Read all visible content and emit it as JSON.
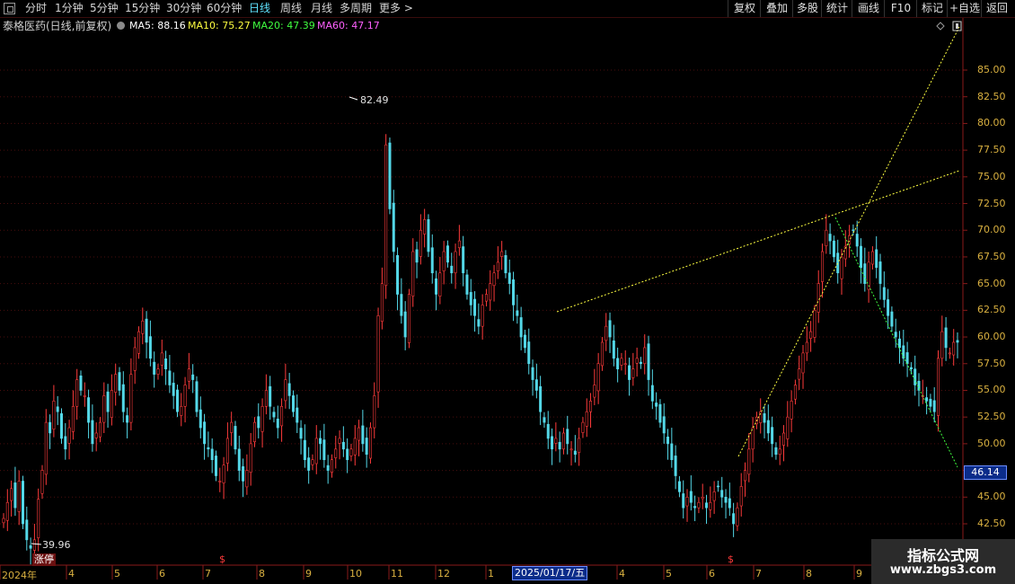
{
  "toolbar": {
    "periods": [
      "分时",
      "1分钟",
      "5分钟",
      "15分钟",
      "30分钟",
      "60分钟",
      "日线",
      "周线",
      "月线",
      "多周期",
      "更多 >"
    ],
    "active_period": "日线",
    "right_buttons": [
      "复权",
      "叠加",
      "多股",
      "统计",
      "画线",
      "F10",
      "标记",
      "+自选",
      "返回"
    ]
  },
  "legend": {
    "title": "泰格医药(日线,前复权)",
    "ma5": "MA5: 88.16",
    "ma10": "MA10: 75.27",
    "ma20": "MA20: 47.39",
    "ma60": "MA60: 47.17"
  },
  "colors": {
    "up": "#ff3b3b",
    "down": "#54d8e8",
    "ma5": "#ffffff",
    "ma10": "#ffff40",
    "ma20": "#40ff40",
    "ma60": "#ff60ff",
    "axis_text": "#d9b040",
    "grid": "#4a0e0e",
    "trend_line": "#ffff40",
    "down_trend_line": "#40ff40"
  },
  "price_axis": {
    "ticks": [
      "85.00",
      "82.50",
      "80.00",
      "77.50",
      "75.00",
      "72.50",
      "70.00",
      "67.50",
      "65.00",
      "62.50",
      "60.00",
      "57.50",
      "55.00",
      "52.50",
      "50.00",
      "47.50",
      "45.00",
      "42.50"
    ],
    "tick_values": [
      85,
      82.5,
      80,
      77.5,
      75,
      72.5,
      70,
      67.5,
      65,
      62.5,
      60,
      57.5,
      55,
      52.5,
      50,
      47.5,
      45,
      42.5
    ],
    "current_price": "46.14"
  },
  "time_axis": {
    "labels": [
      "2024年",
      "4",
      "5",
      "6",
      "7",
      "8",
      "9",
      "10",
      "11",
      "12",
      "1",
      "2025/01/17/五",
      "4",
      "5",
      "6",
      "7",
      "8",
      "9"
    ],
    "dividend_markers": [
      "$",
      "$"
    ]
  },
  "annotations": {
    "high": "82.49",
    "low": "39.96",
    "zhangting": "涨停"
  },
  "watermark": {
    "title": "指标公式网",
    "url": "www.zbgs3.com"
  },
  "chart_data": {
    "type": "candlestick",
    "ylim": [
      39.5,
      89
    ],
    "close_series": [
      43,
      44.5,
      45.8,
      44,
      46.5,
      42.5,
      41,
      40.2,
      41,
      44.8,
      47.5,
      52,
      51,
      54,
      53,
      50.5,
      49.5,
      51.5,
      53.5,
      56,
      55,
      54.5,
      52,
      50,
      51,
      52,
      54.5,
      53,
      55,
      56.5,
      55,
      53,
      52,
      56.5,
      59,
      60.5,
      61.5,
      59.5,
      58,
      56.5,
      57,
      58.5,
      57,
      55.5,
      54.5,
      53,
      53.5,
      55.5,
      57,
      56,
      53,
      51.5,
      50,
      49.5,
      48.5,
      47,
      46.5,
      48,
      50.5,
      52,
      49.5,
      47.5,
      46.5,
      47.5,
      50,
      52,
      51.5,
      53.5,
      55,
      53.5,
      52.5,
      51.5,
      53.5,
      56,
      54.5,
      53,
      52,
      50.5,
      48.5,
      47.5,
      48.5,
      50.5,
      50,
      48.5,
      47.5,
      48.5,
      49.5,
      50.5,
      49.5,
      48.5,
      49.5,
      50.5,
      51.5,
      50,
      49,
      51.5,
      54.5,
      62,
      65,
      78,
      72,
      68,
      64,
      62,
      60,
      64,
      68,
      67,
      70,
      71,
      68,
      66,
      64,
      66,
      68,
      67,
      66,
      68,
      69,
      66,
      64,
      63,
      62,
      61,
      63,
      64,
      65,
      66,
      67,
      68,
      66,
      65,
      63,
      62,
      60,
      59,
      57.5,
      56,
      55,
      53,
      52,
      50.5,
      49.5,
      50.5,
      49.5,
      51,
      50,
      49.5,
      49,
      50.5,
      52,
      53,
      54,
      55.5,
      57.5,
      59.5,
      61,
      60,
      58,
      57,
      58,
      57.5,
      56,
      57,
      58,
      57.5,
      59,
      56,
      54,
      53.5,
      52,
      51,
      50,
      48.5,
      47,
      45.5,
      44,
      45,
      44.5,
      44,
      44.5,
      45,
      44,
      44.5,
      45.5,
      46,
      45,
      44.5,
      44,
      42.5,
      44,
      46,
      47.5,
      49.5,
      51.5,
      52.5,
      53,
      52,
      51,
      50,
      49,
      49.5,
      51,
      52.5,
      54,
      55.5,
      57,
      58.5,
      59.5,
      60.5,
      62.5,
      65,
      68,
      70,
      69,
      67.5,
      66,
      67.5,
      68.5,
      69.5,
      70,
      68.5,
      66.5,
      65,
      67,
      68,
      66.5,
      65,
      63.5,
      62,
      61,
      60,
      59,
      58,
      57.5,
      57,
      55.5,
      55,
      54.5,
      54,
      53.5,
      53,
      58,
      60.5,
      59,
      58.5,
      59.5,
      59.5
    ]
  }
}
